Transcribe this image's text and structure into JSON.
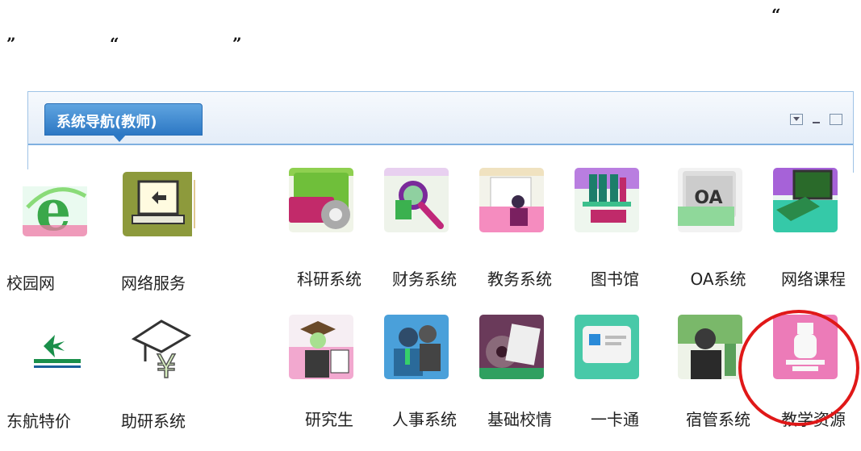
{
  "quotes": {
    "q1": "“",
    "q2": "”",
    "q3": "“",
    "q4": "”"
  },
  "panel": {
    "title": "系统导航(教师)"
  },
  "window_controls": {
    "menu": "dropdown-menu-icon",
    "minimize": "minimize-icon",
    "maximize": "maximize-icon"
  },
  "row1": [
    {
      "label": "校园网",
      "icon": "ie-browser-icon",
      "color": "#3aa84a"
    },
    {
      "label": "网络服务",
      "icon": "laptop-icon",
      "color": "#8d9a3c"
    },
    {
      "label": "科研系统",
      "icon": "research-gear-icon",
      "color": "#b8256a"
    },
    {
      "label": "财务系统",
      "icon": "magnifier-icon",
      "color": "#6dbb52"
    },
    {
      "label": "教务系统",
      "icon": "teacher-doc-icon",
      "color": "#e05591"
    },
    {
      "label": "图书馆",
      "icon": "bookshelf-icon",
      "color": "#a85cd6"
    },
    {
      "label": "OA系统",
      "icon": "oa-icon",
      "color": "#9a9a9a"
    },
    {
      "label": "网络课程",
      "icon": "online-course-icon",
      "color": "#2cc6a0"
    }
  ],
  "row2": [
    {
      "label": "东航特价",
      "icon": "airline-logo-icon",
      "color": "#1a8f4a"
    },
    {
      "label": "助研系统",
      "icon": "graduation-cap-yen-icon",
      "color": "#444444"
    },
    {
      "label": "研究生",
      "icon": "graduate-icon",
      "color": "#e07ab0"
    },
    {
      "label": "人事系统",
      "icon": "people-icon",
      "color": "#4a9fd8"
    },
    {
      "label": "基础校情",
      "icon": "film-reel-icon",
      "color": "#7a4a6a"
    },
    {
      "label": "一卡通",
      "icon": "id-card-icon",
      "color": "#48c9a8"
    },
    {
      "label": "宿管系统",
      "icon": "dorm-manager-icon",
      "color": "#58a060"
    },
    {
      "label": "教学资源",
      "icon": "microscope-icon",
      "color": "#e870b0"
    }
  ]
}
